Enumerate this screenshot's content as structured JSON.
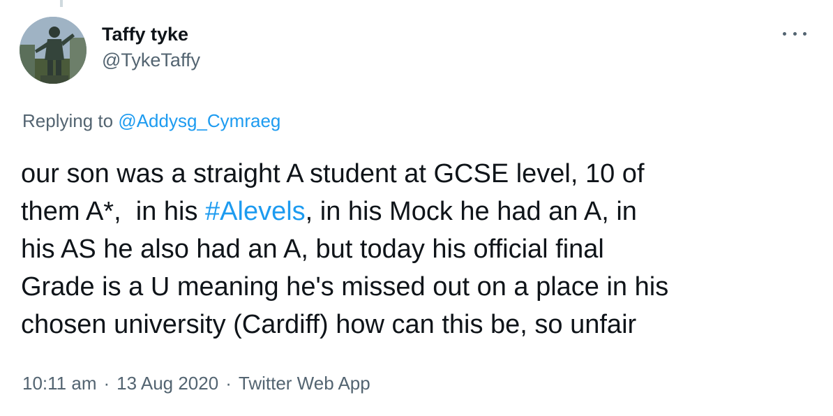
{
  "author": {
    "display_name": "Taffy tyke",
    "handle": "@TykeTaffy",
    "avatar_icon": "statue-avatar"
  },
  "menu": {
    "icon": "more-options-icon"
  },
  "reply": {
    "prefix": "Replying to ",
    "mention": "@Addysg_Cymraeg"
  },
  "tweet": {
    "text_before": "our son was a straight A student at GCSE level, 10 of\nthem A*,  in his ",
    "hashtag": "#Alevels",
    "text_after": ", in his Mock he had an A, in\nhis AS he also had an A, but today his official final\nGrade is a U meaning he's missed out on a place in his\nchosen university (Cardiff) how can this be, so unfair"
  },
  "meta": {
    "time": "10:11 am",
    "separator": "·",
    "date": "13 Aug 2020",
    "source": "Twitter Web App"
  },
  "colors": {
    "link": "#1d9bf0",
    "secondary_text": "#536471",
    "primary_text": "#0f1419"
  }
}
